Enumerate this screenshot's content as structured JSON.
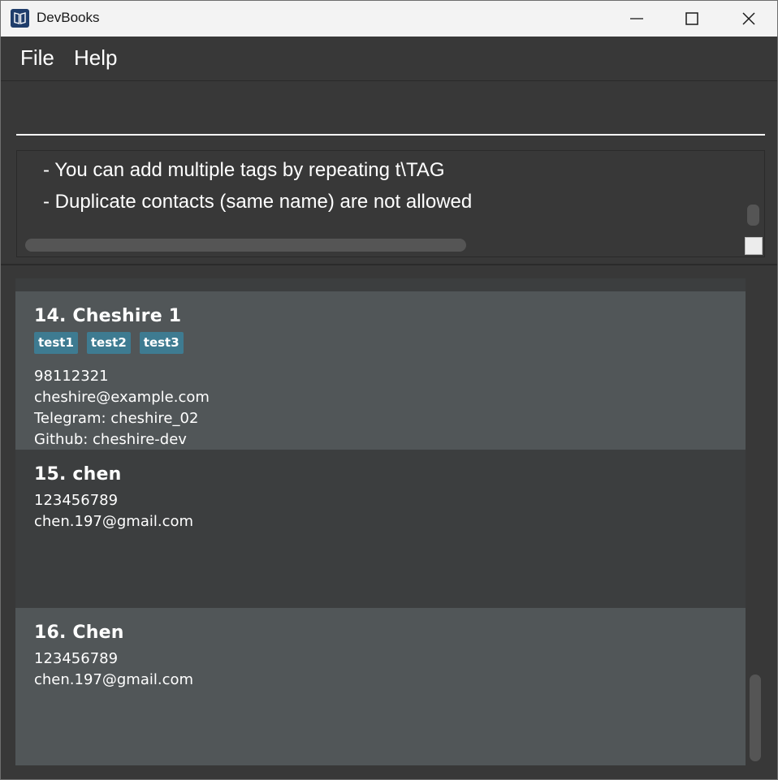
{
  "window": {
    "title": "DevBooks"
  },
  "menu": {
    "items": [
      "File",
      "Help"
    ]
  },
  "command": {
    "value": "",
    "placeholder": ""
  },
  "result": {
    "lines": [
      "- You can add multiple tags by repeating t\\TAG",
      "- Duplicate contacts (same name) are not allowed"
    ]
  },
  "persons": [
    {
      "name": "14. Cheshire 1",
      "tags": [
        "test1",
        "test2",
        "test3"
      ],
      "phone": "98112321",
      "email": "cheshire@example.com",
      "telegram": "Telegram: cheshire_02",
      "github": "Github: cheshire-dev"
    },
    {
      "name": "15. chen",
      "phone": "123456789",
      "email": "chen.197@gmail.com"
    },
    {
      "name": "16. Chen",
      "phone": "123456789",
      "email": "chen.197@gmail.com"
    }
  ],
  "colors": {
    "background": "#383838",
    "card_odd": "#515658",
    "card_even": "#3c3e3f",
    "tag": "#3e7b91",
    "titlebar": "#f3f3f3"
  },
  "icons": {
    "app": "book-icon",
    "minimize": "minimize-icon",
    "maximize": "maximize-icon",
    "close": "close-icon"
  }
}
